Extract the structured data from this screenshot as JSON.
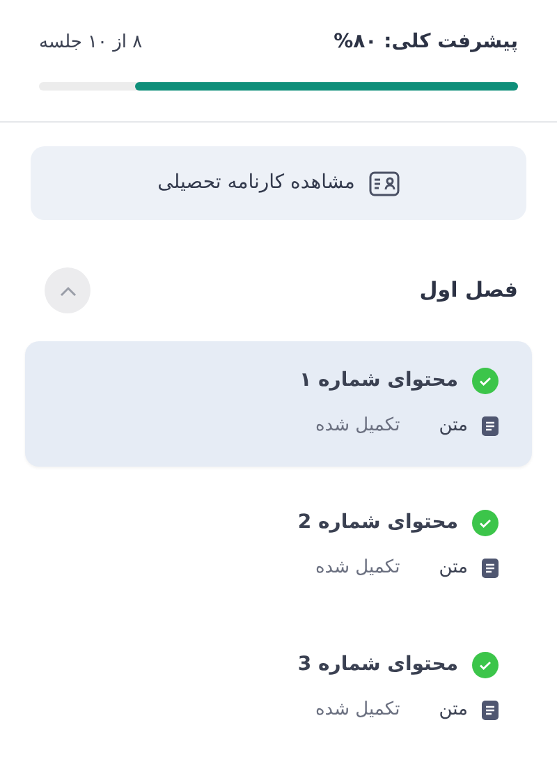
{
  "progress": {
    "label": "پیشرفت کلی: ۸۰%",
    "sessions": "۸ از ۱۰ جلسه",
    "level": 0.8
  },
  "report_button": {
    "label": "مشاهده کارنامه تحصیلی"
  },
  "section": {
    "title": "فصل اول",
    "expanded": true,
    "items": [
      {
        "title": "محتوای شماره ۱",
        "type": "متن",
        "status": "تکمیل شده",
        "completed": true,
        "selected": true
      },
      {
        "title": "محتوای شماره 2",
        "type": "متن",
        "status": "تکمیل شده",
        "completed": true,
        "selected": false
      },
      {
        "title": "محتوای شماره 3",
        "type": "متن",
        "status": "تکمیل شده",
        "completed": true,
        "selected": false
      }
    ]
  }
}
